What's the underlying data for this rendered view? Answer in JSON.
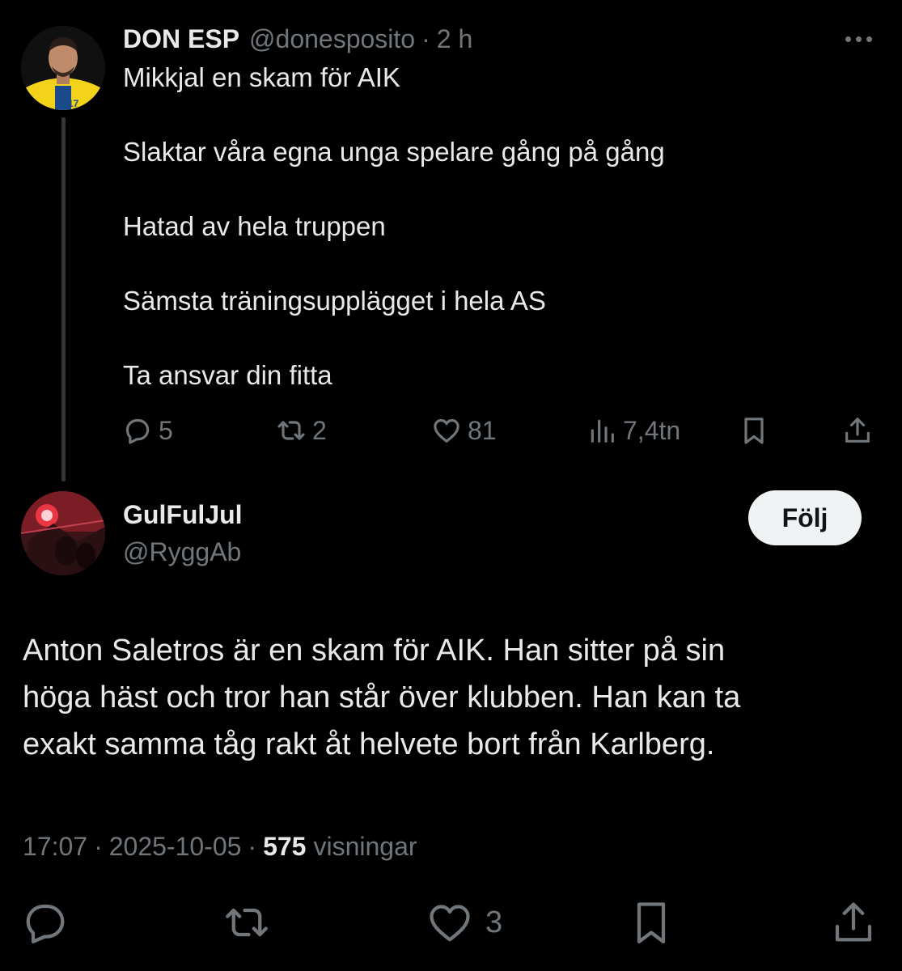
{
  "parent_tweet": {
    "display_name": "DON ESP",
    "handle": "@donesposito",
    "separator": "·",
    "time": "2 h",
    "lines": [
      "Mikkjal en skam för AIK",
      "Slaktar våra egna unga spelare gång på gång",
      "Hatad av hela truppen",
      "Sämsta träningsupplägget i hela AS",
      "Ta ansvar din fitta"
    ],
    "replies": "5",
    "retweets": "2",
    "likes": "81",
    "views": "7,4tn"
  },
  "main_tweet": {
    "display_name": "GulFulJul",
    "handle": "@RyggAb",
    "follow_label": "Följ",
    "lines": [
      "Anton Saletros är en skam för AIK. Han sitter på sin",
      "höga häst och tror han står över klubben. Han kan ta",
      "exakt samma tåg rakt åt helvete bort från Karlberg."
    ],
    "time": "17:07",
    "date": "2025-10-05",
    "separator": "·",
    "views_count": "575",
    "views_label": "visningar",
    "likes": "3"
  },
  "icons": {
    "reply": "reply-icon",
    "retweet": "retweet-icon",
    "like": "heart-icon",
    "views": "views-chart-icon",
    "bookmark": "bookmark-icon",
    "share": "share-icon",
    "more": "more-dots-icon"
  },
  "colors": {
    "background": "#000000",
    "text_primary": "#e7e9ea",
    "text_secondary": "#71767b",
    "thread_line": "#333639",
    "follow_bg": "#eff3f4"
  }
}
